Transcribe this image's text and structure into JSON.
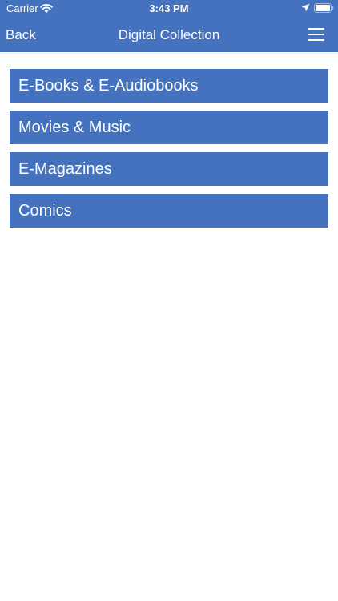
{
  "colors": {
    "accent": "#4472BE",
    "text_on_accent": "#FFFFFF",
    "background": "#FFFFFF"
  },
  "status_bar": {
    "carrier": "Carrier",
    "time": "3:43 PM",
    "icons": [
      "wifi-icon",
      "location-icon",
      "battery-icon"
    ]
  },
  "nav": {
    "back_label": "Back",
    "title": "Digital Collection",
    "menu_icon": "hamburger-menu-icon"
  },
  "menu": {
    "items": [
      {
        "label": "E-Books & E-Audiobooks"
      },
      {
        "label": "Movies & Music"
      },
      {
        "label": "E-Magazines"
      },
      {
        "label": "Comics"
      }
    ]
  }
}
